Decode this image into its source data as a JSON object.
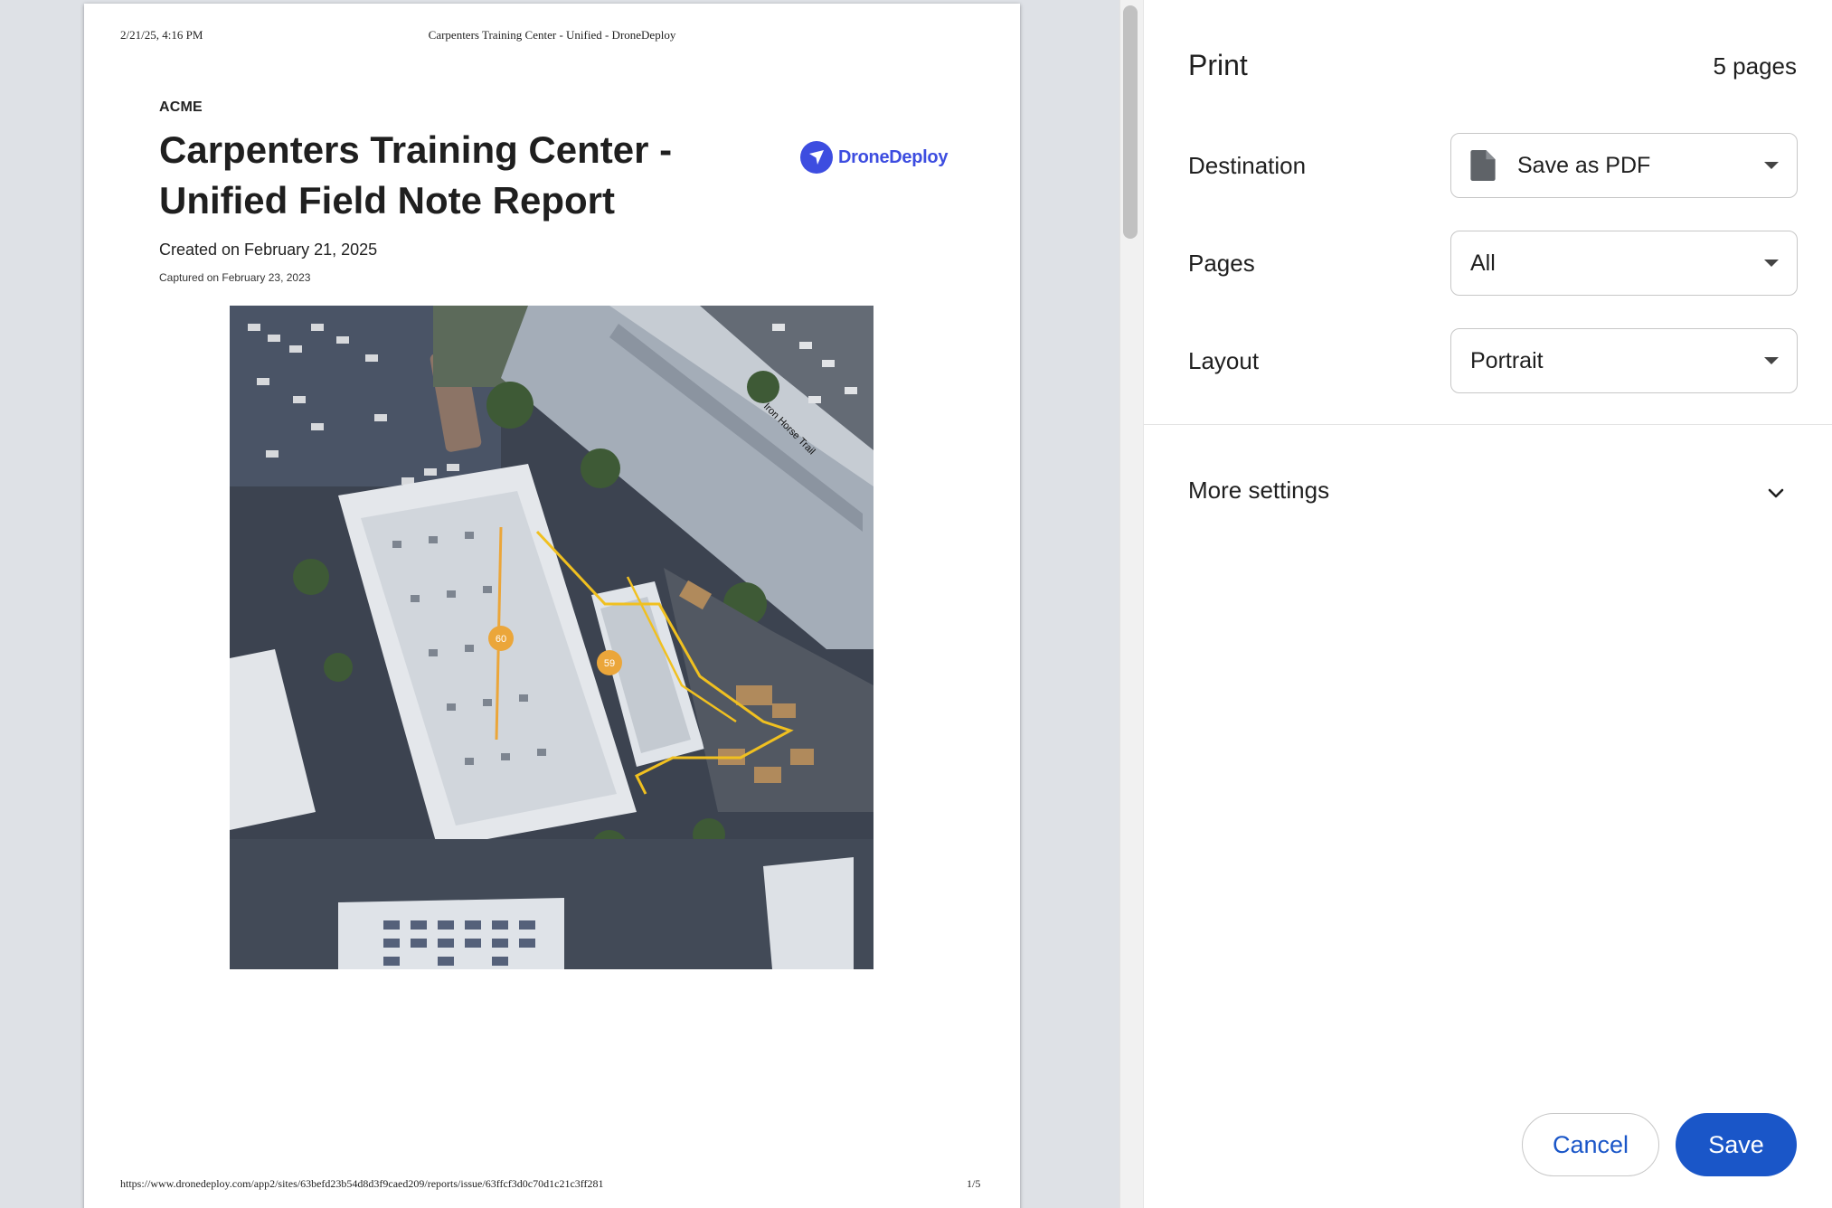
{
  "preview": {
    "header_date": "2/21/25, 4:16 PM",
    "header_title": "Carpenters Training Center - Unified - DroneDeploy",
    "org": "ACME",
    "report_title": "Carpenters Training Center - Unified Field Note Report",
    "brand_name": "DroneDeploy",
    "created": "Created on February 21, 2025",
    "captured": "Captured on February 23, 2023",
    "map_label": "Iron Horse Trail",
    "markers": [
      "60",
      "59"
    ],
    "footer_url": "https://www.dronedeploy.com/app2/sites/63befd23b54d8d3f9caed209/reports/issue/63ffcf3d0c70d1c21c3ff281",
    "footer_page": "1/5"
  },
  "panel": {
    "title": "Print",
    "page_count": "5 pages",
    "destination": {
      "label": "Destination",
      "value": "Save as PDF"
    },
    "pages": {
      "label": "Pages",
      "value": "All"
    },
    "layout": {
      "label": "Layout",
      "value": "Portrait"
    },
    "more_settings": "More settings",
    "cancel": "Cancel",
    "save": "Save"
  },
  "colors": {
    "accent": "#1a56c8",
    "brand": "#3d4de0",
    "marker": "#eba63a"
  }
}
